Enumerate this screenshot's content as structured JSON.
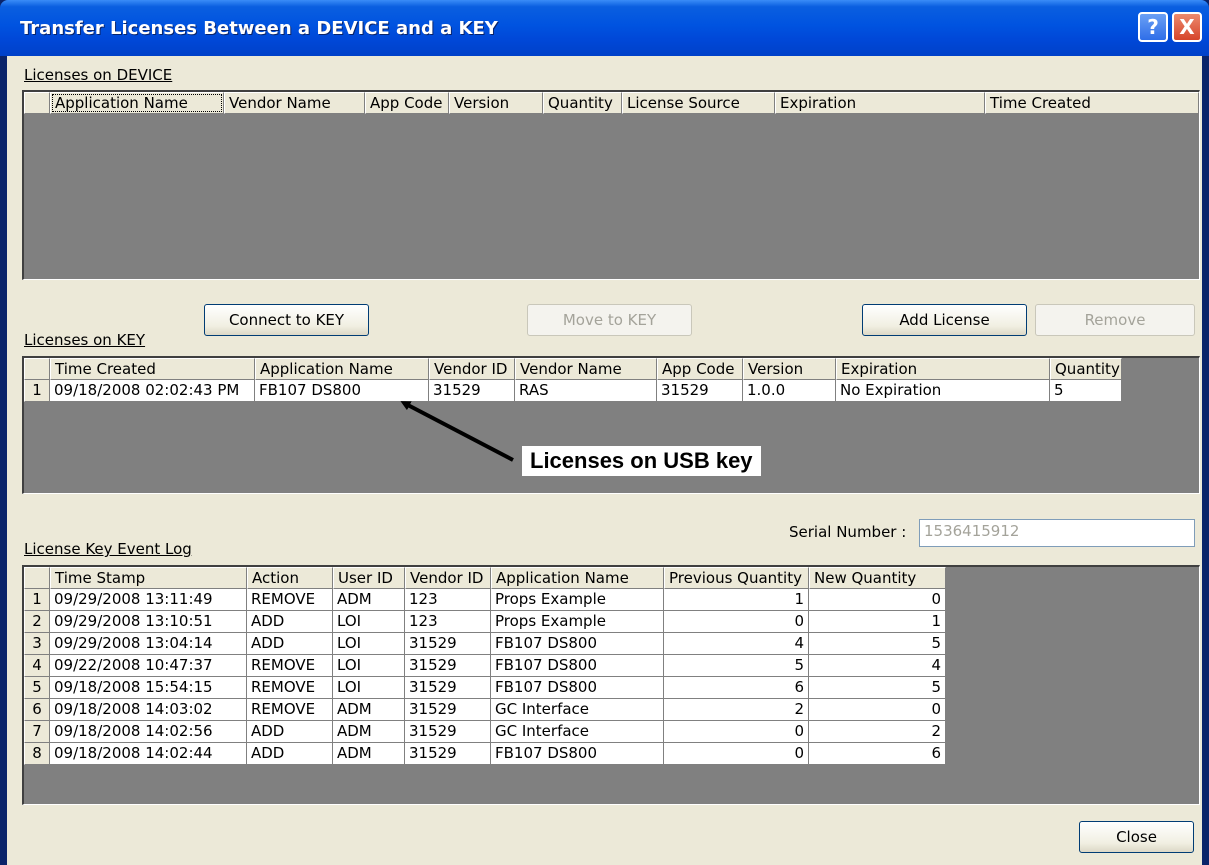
{
  "window": {
    "title": "Transfer Licenses Between a DEVICE and a KEY",
    "help_glyph": "?",
    "close_glyph": "X"
  },
  "device": {
    "label": "Licenses on DEVICE",
    "columns": [
      "Application Name",
      "Vendor Name",
      "App Code",
      "Version",
      "Quantity",
      "License Source",
      "Expiration",
      "Time Created"
    ]
  },
  "buttons": {
    "connect": "Connect to KEY",
    "move": "Move to KEY",
    "add": "Add License",
    "remove": "Remove",
    "close": "Close"
  },
  "key": {
    "label": "Licenses on KEY",
    "columns": [
      "Time Created",
      "Application Name",
      "Vendor ID",
      "Vendor Name",
      "App Code",
      "Version",
      "Expiration",
      "Quantity"
    ],
    "rows": [
      {
        "n": "1",
        "cells": [
          "09/18/2008 02:02:43 PM",
          "FB107 DS800",
          "31529",
          "RAS",
          "31529",
          "1.0.0",
          "No Expiration",
          "5"
        ]
      }
    ]
  },
  "annotation": {
    "text": "Licenses on USB key"
  },
  "serial": {
    "label": "Serial Number :",
    "value": "1536415912"
  },
  "log": {
    "label": "License Key Event Log",
    "columns": [
      "Time Stamp",
      "Action",
      "User ID",
      "Vendor ID",
      "Application Name",
      "Previous Quantity",
      "New Quantity"
    ],
    "rows": [
      {
        "n": "1",
        "cells": [
          "09/29/2008 13:11:49",
          "REMOVE",
          "ADM",
          "123",
          "Props Example",
          "1",
          "0"
        ]
      },
      {
        "n": "2",
        "cells": [
          "09/29/2008 13:10:51",
          "ADD",
          "LOI",
          "123",
          "Props Example",
          "0",
          "1"
        ]
      },
      {
        "n": "3",
        "cells": [
          "09/29/2008 13:04:14",
          "ADD",
          "LOI",
          "31529",
          "FB107 DS800",
          "4",
          "5"
        ]
      },
      {
        "n": "4",
        "cells": [
          "09/22/2008 10:47:37",
          "REMOVE",
          "LOI",
          "31529",
          "FB107 DS800",
          "5",
          "4"
        ]
      },
      {
        "n": "5",
        "cells": [
          "09/18/2008 15:54:15",
          "REMOVE",
          "LOI",
          "31529",
          "FB107 DS800",
          "6",
          "5"
        ]
      },
      {
        "n": "6",
        "cells": [
          "09/18/2008 14:03:02",
          "REMOVE",
          "ADM",
          "31529",
          "GC Interface",
          "2",
          "0"
        ]
      },
      {
        "n": "7",
        "cells": [
          "09/18/2008 14:02:56",
          "ADD",
          "ADM",
          "31529",
          "GC Interface",
          "0",
          "2"
        ]
      },
      {
        "n": "8",
        "cells": [
          "09/18/2008 14:02:44",
          "ADD",
          "ADM",
          "31529",
          "FB107 DS800",
          "0",
          "6"
        ]
      }
    ]
  },
  "colors": {
    "titlebar": "#0053e0",
    "dialog_bg": "#ece9d8",
    "grid_bg": "#808080"
  }
}
